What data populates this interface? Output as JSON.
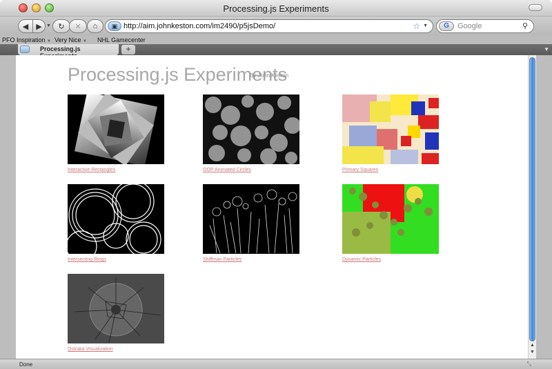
{
  "window": {
    "title": "Processing.js Experiments"
  },
  "toolbar": {
    "back_icon": "◀",
    "forward_icon": "▶",
    "reload_icon": "↻",
    "stop_icon": "✕",
    "home_icon": "⌂",
    "url": "http://aim.johnkeston.com/im2490/p5jsDemo/",
    "search_placeholder": "Google"
  },
  "bookmarks": [
    {
      "label": "PFO Inspiration"
    },
    {
      "label": "Very Nice"
    },
    {
      "label": "NHL Gamecenter"
    }
  ],
  "tab": {
    "label": "Processing.js Experiments",
    "new_tab": "+"
  },
  "page": {
    "title": "Processing.js Experiments",
    "byline": "By John Keston",
    "items": [
      {
        "label": "Interactive Rectangles"
      },
      {
        "label": "OOP Animated Circles"
      },
      {
        "label": "Primary Squares"
      },
      {
        "label": "Intersecting Rings"
      },
      {
        "label": "Shiffman Particles"
      },
      {
        "label": "Dynamic Particles"
      },
      {
        "label": "Ostraka Visualization"
      }
    ]
  },
  "status": {
    "text": "Done"
  },
  "colors": {
    "link": "#cc7777",
    "title": "#a7a7a7"
  }
}
